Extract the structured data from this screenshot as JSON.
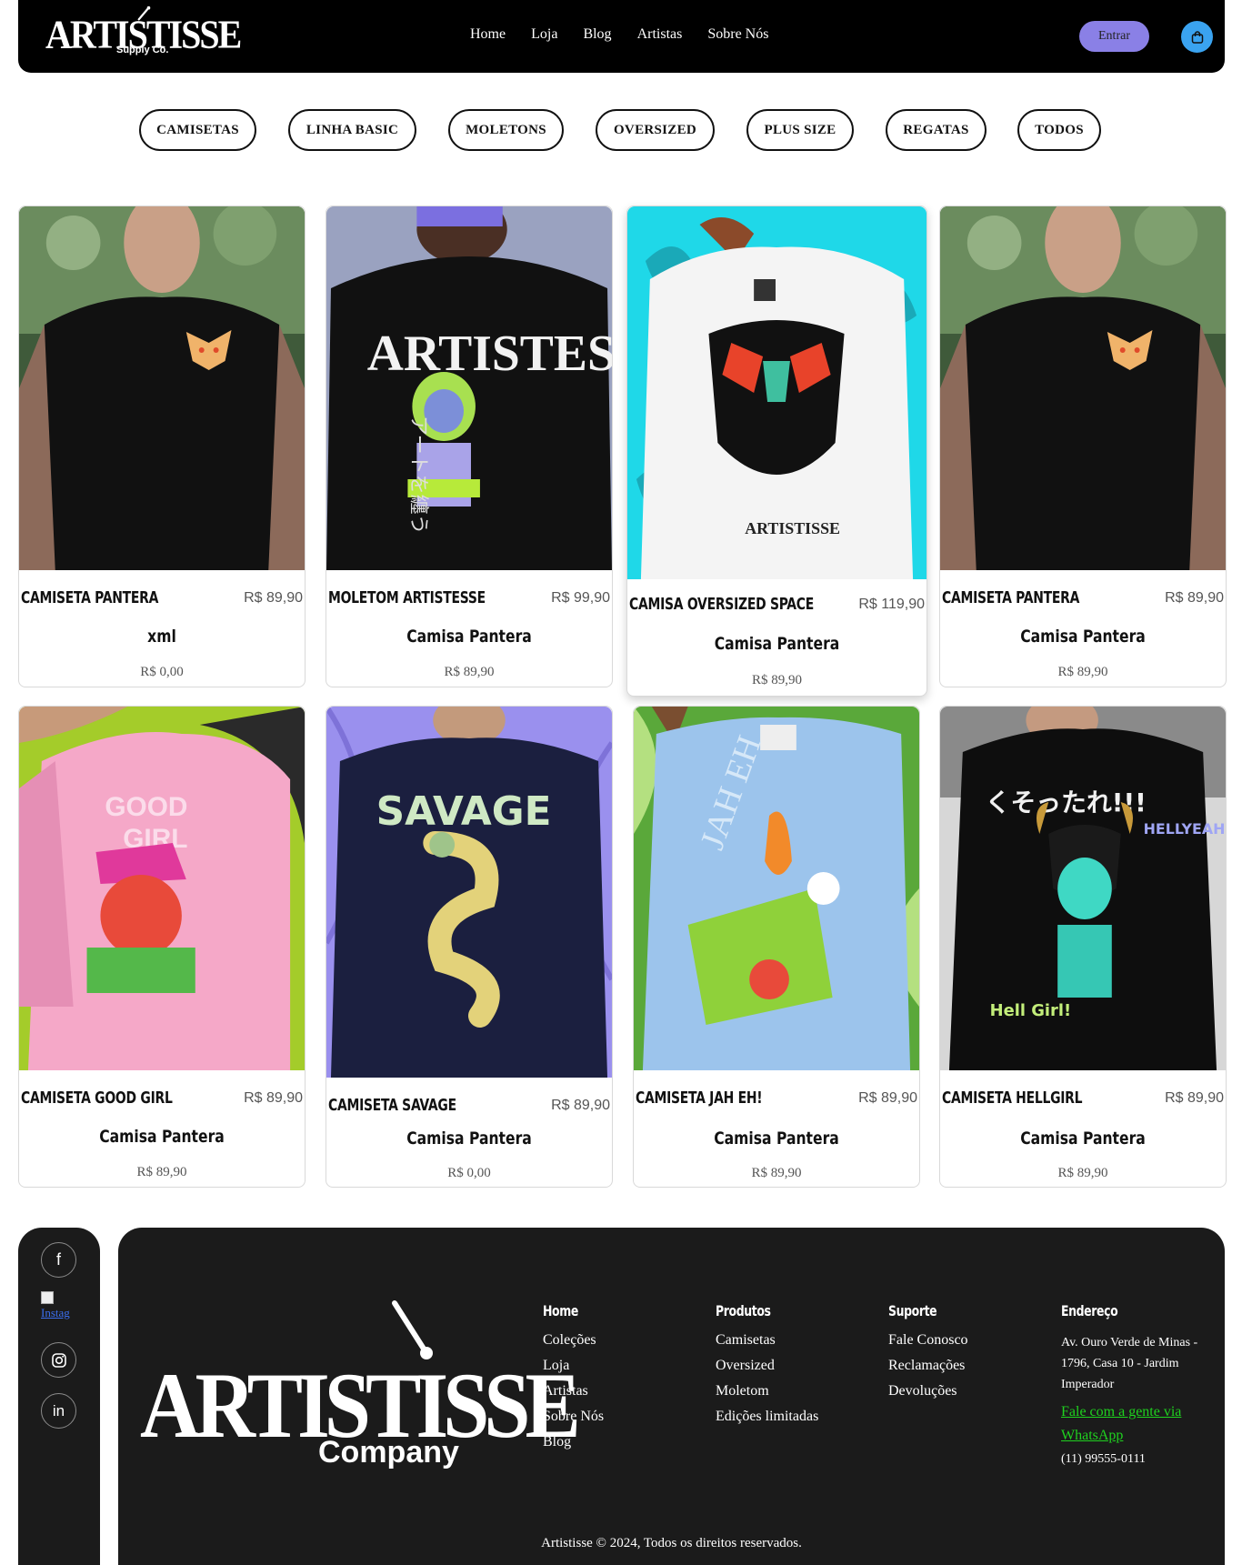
{
  "header": {
    "logo_text": "ARTISTISSE",
    "logo_sub": "Supply Co.",
    "nav": [
      "Home",
      "Loja",
      "Blog",
      "Artistas",
      "Sobre Nós"
    ],
    "login_label": "Entrar",
    "cart_icon": "shopping-bag-icon",
    "accent_color": "#8a80e6",
    "cart_color": "#3aa3f0"
  },
  "categories": [
    "CAMISETAS",
    "LINHA BASIC",
    "MOLETONS",
    "OVERSIZED",
    "PLUS SIZE",
    "REGATAS",
    "TODOS"
  ],
  "products": [
    {
      "name": "CAMISETA PANTERA",
      "price": "R$ 89,90",
      "subtitle": "xml",
      "subprice": "R$ 0,00"
    },
    {
      "name": "MOLETOM ARTISTESSE",
      "price": "R$ 99,90",
      "subtitle": "Camisa Pantera",
      "subprice": "R$ 89,90"
    },
    {
      "name": "CAMISA OVERSIZED SPACE",
      "price": "R$ 119,90",
      "subtitle": "Camisa Pantera",
      "subprice": "R$ 89,90"
    },
    {
      "name": "CAMISETA PANTERA",
      "price": "R$ 89,90",
      "subtitle": "Camisa Pantera",
      "subprice": "R$ 89,90"
    },
    {
      "name": "CAMISETA GOOD GIRL",
      "price": "R$ 89,90",
      "subtitle": "Camisa Pantera",
      "subprice": "R$ 89,90"
    },
    {
      "name": "CAMISETA SAVAGE",
      "price": "R$ 89,90",
      "subtitle": "Camisa Pantera",
      "subprice": "R$ 0,00"
    },
    {
      "name": "CAMISETA JAH EH!",
      "price": "R$ 89,90",
      "subtitle": "Camisa Pantera",
      "subprice": "R$ 89,90"
    },
    {
      "name": "CAMISETA HELLGIRL",
      "price": "R$ 89,90",
      "subtitle": "Camisa Pantera",
      "subprice": "R$ 89,90"
    }
  ],
  "social": {
    "icons": [
      "facebook-icon",
      "instagram-icon",
      "linkedin-icon"
    ],
    "broken_image_alt": "Instag"
  },
  "footer": {
    "logo_text": "ARTISTISSE",
    "logo_sub": "Company",
    "columns": [
      {
        "title": "Home",
        "links": [
          "Coleções",
          "Loja",
          "Artistas",
          "Sobre Nós",
          "Blog"
        ]
      },
      {
        "title": "Produtos",
        "links": [
          "Camisetas",
          "Oversized",
          "Moletom",
          "Edições limitadas"
        ]
      },
      {
        "title": "Suporte",
        "links": [
          "Fale Conosco",
          "Reclamações",
          "Devoluções"
        ]
      }
    ],
    "address_title": "Endereço",
    "address": "Av. Ouro Verde de Minas - 1796, Casa 10 - Jardim Imperador",
    "whatsapp_label": "Fale com a gente via WhatsApp",
    "phone": "(11) 99555-0111",
    "copyright": "Artistisse © 2024, Todos os direitos reservados.",
    "whatsapp_color": "#1fd21f"
  }
}
